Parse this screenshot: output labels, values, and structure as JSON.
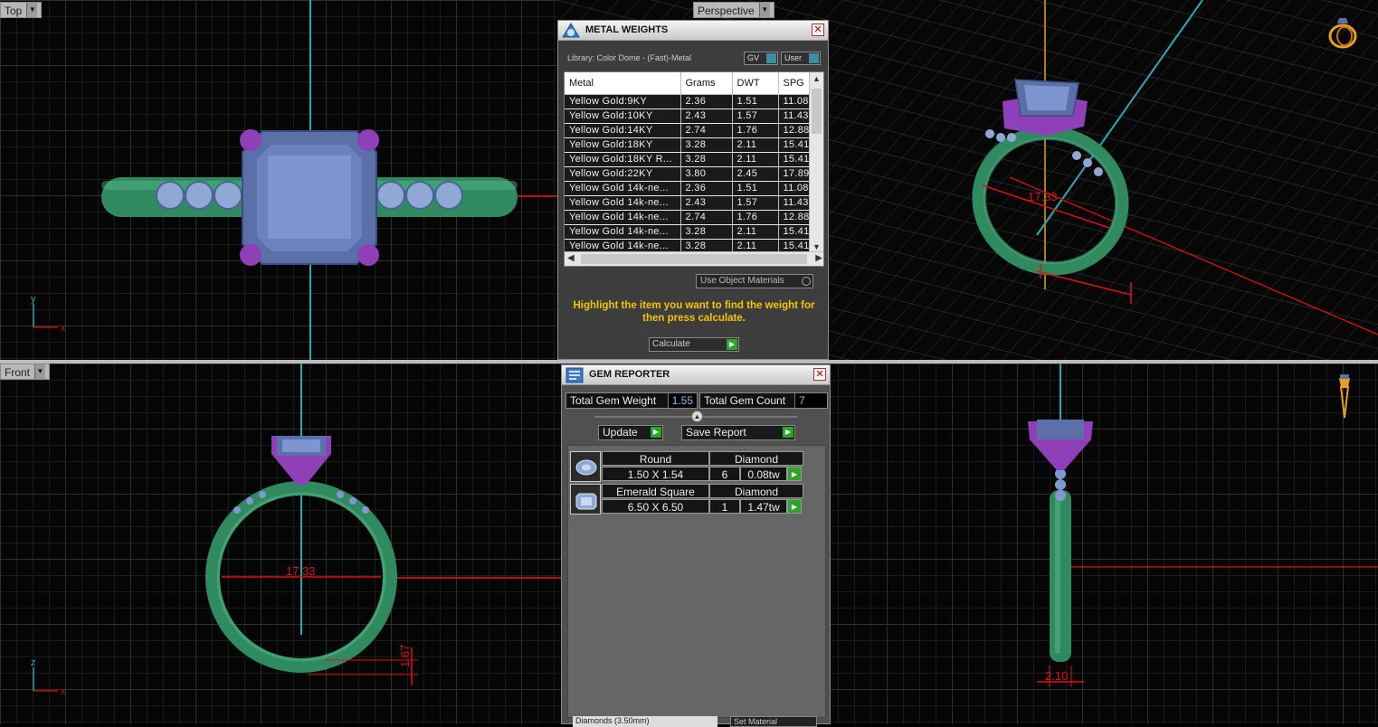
{
  "viewports": {
    "top": {
      "label": "Top",
      "dropdown_icon": "chevron-down-icon"
    },
    "perspective": {
      "label": "Perspective",
      "dropdown_icon": "chevron-down-icon"
    },
    "front": {
      "label": "Front",
      "dropdown_icon": "chevron-down-icon"
    }
  },
  "axes": {
    "x": "x",
    "y": "y",
    "z": "z"
  },
  "dimensions": {
    "front_diameter": "17.33",
    "front_thickness": "1.67",
    "side_width": "2.10",
    "persp_diameter": "17.33"
  },
  "metal_weights": {
    "title": "METAL WEIGHTS",
    "library": "Library: Color Dome - (Fast)-Metal",
    "gv_label": "GV",
    "user_label": "User",
    "columns": [
      "Metal",
      "Grams",
      "DWT",
      "SPG"
    ],
    "rows": [
      [
        "Yellow Gold:9KY",
        "2.36",
        "1.51",
        "11.08"
      ],
      [
        "Yellow Gold:10KY",
        "2.43",
        "1.57",
        "11.43"
      ],
      [
        "Yellow Gold:14KY",
        "2.74",
        "1.76",
        "12.88"
      ],
      [
        "Yellow Gold:18KY",
        "3.28",
        "2.11",
        "15.41"
      ],
      [
        "Yellow Gold:18KY R...",
        "3.28",
        "2.11",
        "15.41"
      ],
      [
        "Yellow Gold:22KY",
        "3.80",
        "2.45",
        "17.89"
      ],
      [
        "Yellow Gold 14k-ne...",
        "2.36",
        "1.51",
        "11.08"
      ],
      [
        "Yellow Gold 14k-ne...",
        "2.43",
        "1.57",
        "11.43"
      ],
      [
        "Yellow Gold 14k-ne...",
        "2.74",
        "1.76",
        "12.88"
      ],
      [
        "Yellow Gold 14k-ne...",
        "3.28",
        "2.11",
        "15.41"
      ],
      [
        "Yellow Gold 14k-ne...",
        "3.28",
        "2.11",
        "15.41"
      ]
    ],
    "use_object_materials": "Use Object Materials",
    "hint": "Highlight the item you want to find the weight for then press calculate.",
    "calculate_label": "Calculate"
  },
  "gem_reporter": {
    "title": "GEM REPORTER",
    "total_weight_label": "Total Gem Weight",
    "total_weight": "1.55",
    "total_count_label": "Total Gem Count",
    "total_count": "7",
    "update_label": "Update",
    "save_report_label": "Save Report",
    "gems": [
      {
        "shape": "Round",
        "material": "Diamond",
        "size": "1.50 X 1.54",
        "count": "6",
        "weight": "0.08tw",
        "icon": "round-gem-icon"
      },
      {
        "shape": "Emerald Square",
        "material": "Diamond",
        "size": "6.50 X 6.50",
        "count": "1",
        "weight": "1.47tw",
        "icon": "emerald-gem-icon"
      }
    ],
    "bottom_left": "Diamonds (3.50mm)",
    "bottom_right": "Set Material"
  },
  "colors": {
    "shank": "#2f8a60",
    "prong": "#8f3fb8",
    "stone": "#6f86c4",
    "dimension": "#e01010",
    "hint": "#f6c400",
    "accent_go": "#2aa52a"
  }
}
